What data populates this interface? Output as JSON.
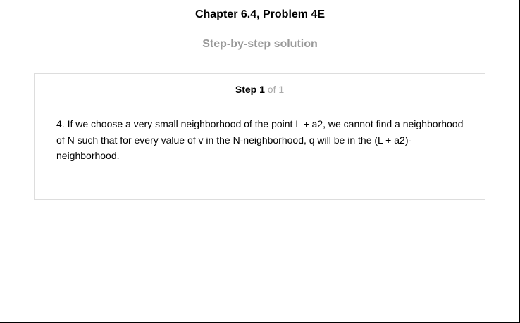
{
  "header": {
    "title": "Chapter 6.4, Problem 4E",
    "subtitle": "Step-by-step solution"
  },
  "step": {
    "label": "Step",
    "current": "1",
    "of_text": " of 1",
    "text": "4. If we choose a very small neighborhood of the point L + a2, we cannot find a neighborhood of N such that for every value of v in the N-neighborhood, q will be in the (L + a2)-neighborhood."
  }
}
